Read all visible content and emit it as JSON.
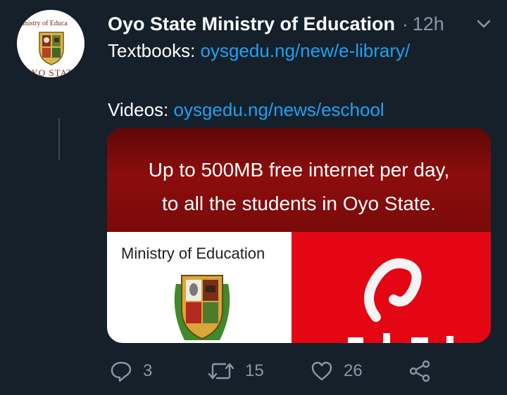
{
  "tweet": {
    "author": "Oyo State Ministry of Education",
    "separator": "·",
    "time": "12h",
    "avatar": {
      "ring_text": "inistry of Educa",
      "state_text": "OYO STATE"
    },
    "lines": {
      "textbooks_label": "Textbooks: ",
      "textbooks_link": "oysgedu.ng/new/e-library/",
      "videos_label": "Videos: ",
      "videos_link": "oysgedu.ng/news/eschool"
    },
    "media": {
      "headline_line1": "Up to 500MB free internet per day,",
      "headline_line2": "to all the students in Oyo State.",
      "panel_label": "Ministry of Education",
      "brand_partial": "airtel"
    },
    "actions": {
      "reply_count": "3",
      "retweet_count": "15",
      "like_count": "26"
    }
  },
  "icons": {
    "more": "chevron-down-icon",
    "reply": "reply-icon",
    "retweet": "retweet-icon",
    "like": "heart-icon",
    "share": "share-icon"
  },
  "colors": {
    "background": "#15202b",
    "link": "#1da1f2",
    "muted": "#8899a6",
    "brand_red": "#e40613"
  }
}
